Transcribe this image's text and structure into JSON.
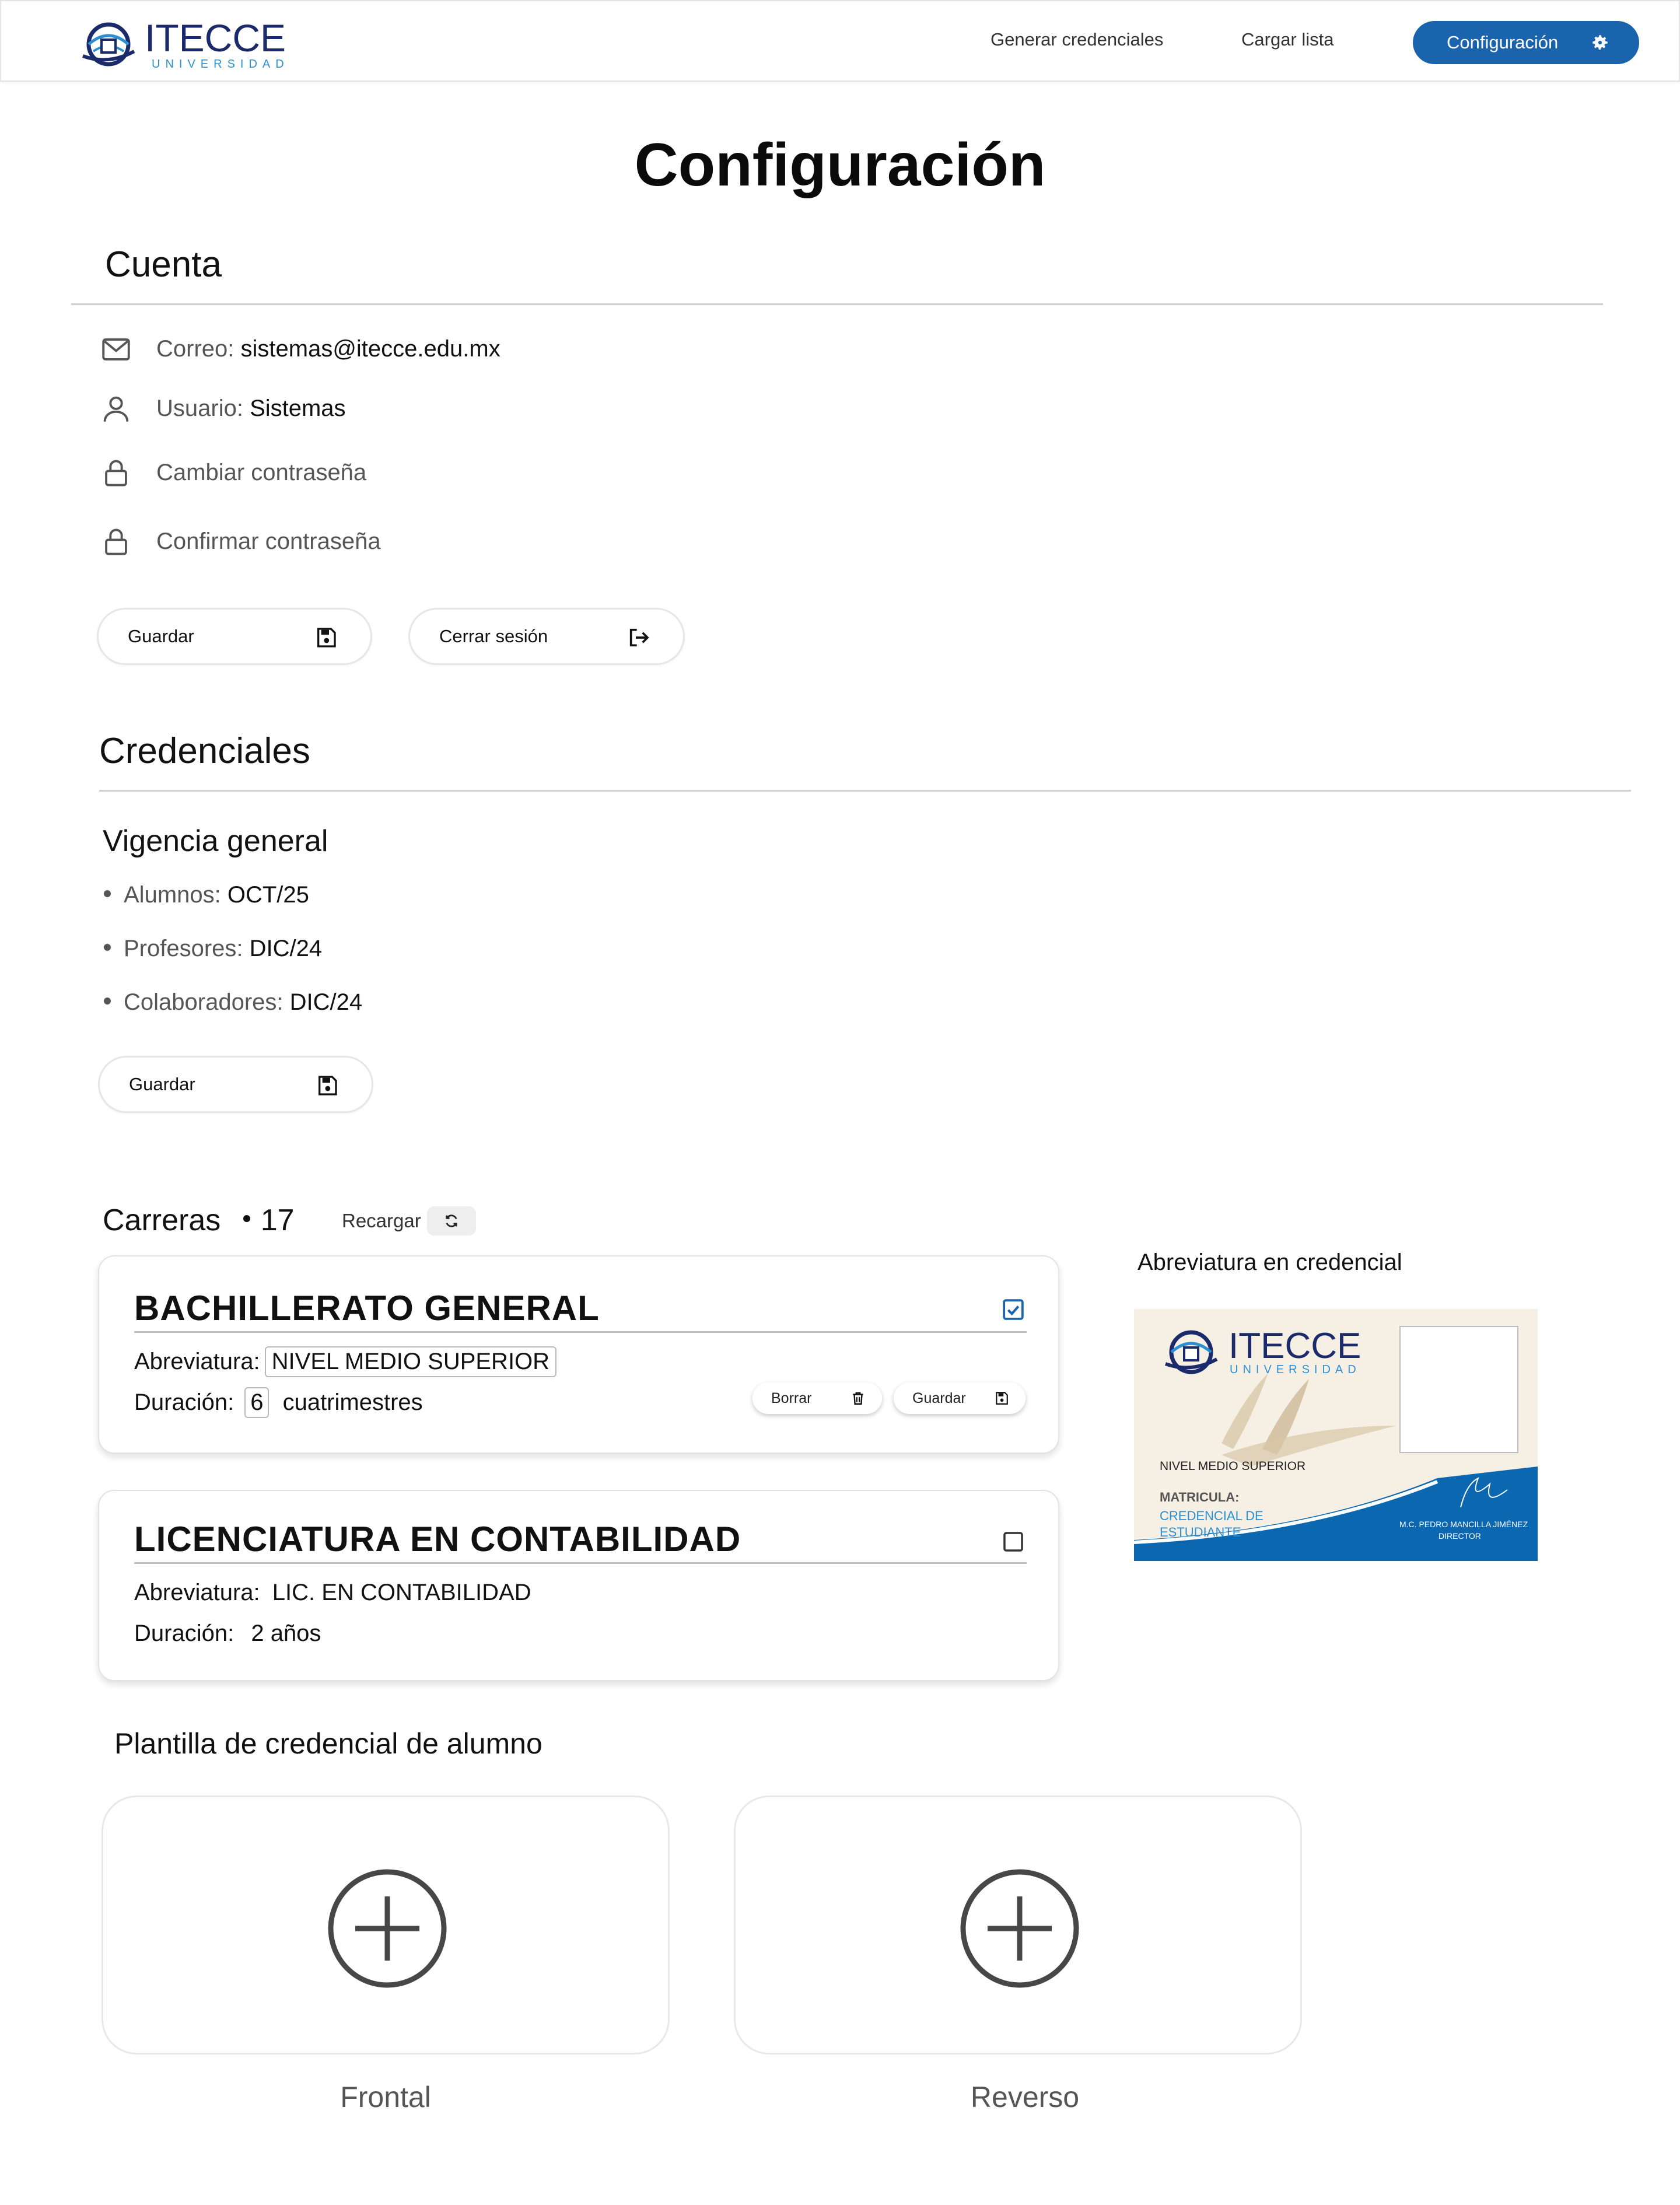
{
  "header": {
    "logo_text": "ITECCE",
    "logo_subtext": "UNIVERSIDAD",
    "nav": {
      "generar": "Generar credenciales",
      "cargar": "Cargar lista",
      "configuracion": "Configuración"
    }
  },
  "page": {
    "title": "Configuración"
  },
  "cuenta": {
    "title": "Cuenta",
    "correo_label": "Correo: ",
    "correo_value": "sistemas@itecce.edu.mx",
    "usuario_label": "Usuario: ",
    "usuario_value": "Sistemas",
    "cambiar": "Cambiar contraseña",
    "confirmar": "Confirmar contraseña",
    "guardar": "Guardar",
    "cerrar": "Cerrar sesión"
  },
  "credenciales": {
    "title": "Credenciales",
    "vigencia_title": "Vigencia general",
    "items": [
      {
        "label": "Alumnos: ",
        "value": "OCT/25"
      },
      {
        "label": "Profesores: ",
        "value": "DIC/24"
      },
      {
        "label": "Colaboradores: ",
        "value": "DIC/24"
      }
    ],
    "guardar": "Guardar"
  },
  "carreras": {
    "title": "Carreras",
    "count": "17",
    "recargar": "Recargar",
    "list": [
      {
        "name": "BACHILLERATO GENERAL",
        "checked": true,
        "abreviatura_label": "Abreviatura:",
        "abreviatura": "NIVEL MEDIO SUPERIOR",
        "duracion_label": "Duración:",
        "duracion_num": "6",
        "duracion_unit": "cuatrimestres",
        "borrar": "Borrar",
        "guardar": "Guardar"
      },
      {
        "name": "LICENCIATURA EN CONTABILIDAD",
        "checked": false,
        "abreviatura_label": "Abreviatura:",
        "abreviatura": "LIC. EN CONTABILIDAD",
        "duracion_label": "Duración:",
        "duracion": "2 años"
      }
    ]
  },
  "preview": {
    "label": "Abreviatura en credencial",
    "nivel": "NIVEL MEDIO SUPERIOR",
    "matricula": "MATRICULA:",
    "credencial_line1": "CREDENCIAL DE",
    "credencial_line2": "ESTUDIANTE",
    "director_name": "M.C. PEDRO MANCILLA JIMÉNEZ",
    "director_title": "DIRECTOR"
  },
  "plantilla": {
    "title": "Plantilla de credencial de alumno",
    "frontal": "Frontal",
    "reverso": "Reverso"
  },
  "colors": {
    "accent": "#1a63ad",
    "card_blue": "#0b68b0",
    "card_cream": "#f6efe3"
  }
}
